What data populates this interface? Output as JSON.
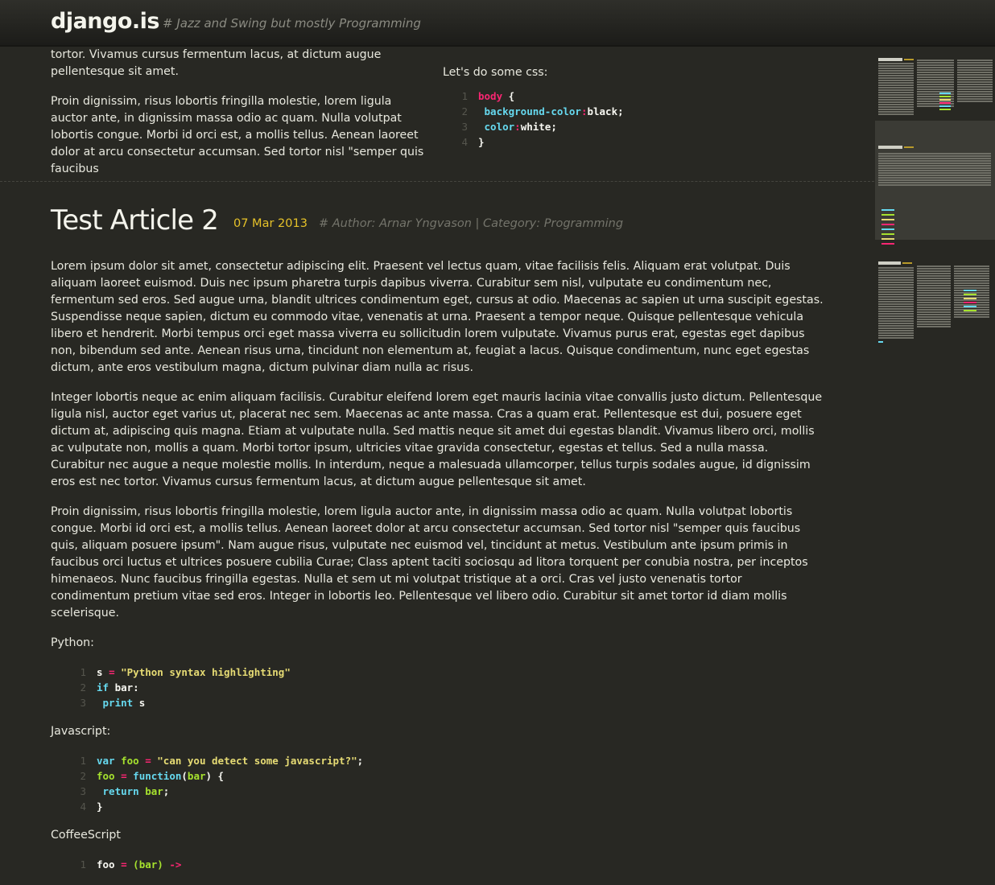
{
  "header": {
    "logo": "django.is",
    "tagline": "# Jazz and Swing but mostly Programming"
  },
  "previous_article": {
    "paragraphs": [
      "tortor. Vivamus cursus fermentum lacus, at dictum augue pellentesque sit amet.",
      "Proin dignissim, risus lobortis fringilla molestie, lorem ligula auctor ante, in dignissim massa odio ac quam. Nulla volutpat lobortis congue. Morbi id orci est, a mollis tellus. Aenean laoreet dolor at arcu consectetur accumsan. Sed tortor nisl \"semper quis faucibus"
    ],
    "css_label": "Let's do some css:",
    "css_code": [
      "body {",
      "    background-color:black;",
      "    color:white;",
      "}"
    ]
  },
  "article": {
    "title": "Test Article 2",
    "date": "07 Mar 2013",
    "meta": "# Author: Arnar Yngvason | Category: Programming",
    "paragraphs": [
      "Lorem ipsum dolor sit amet, consectetur adipiscing elit. Praesent vel lectus quam, vitae facilisis felis. Aliquam erat volutpat. Duis aliquam laoreet euismod. Duis nec ipsum pharetra turpis dapibus viverra. Curabitur sem nisl, vulputate eu condimentum nec, fermentum sed eros. Sed augue urna, blandit ultrices condimentum eget, cursus at odio. Maecenas ac sapien ut urna suscipit egestas. Suspendisse neque sapien, dictum eu commodo vitae, venenatis at urna. Praesent a tempor neque. Quisque pellentesque vehicula libero et hendrerit. Morbi tempus orci eget massa viverra eu sollicitudin lorem vulputate. Vivamus purus erat, egestas eget dapibus non, bibendum sed ante. Aenean risus urna, tincidunt non elementum at, feugiat a lacus. Quisque condimentum, nunc eget egestas dictum, ante eros vestibulum magna, dictum pulvinar diam nulla ac risus.",
      "Integer lobortis neque ac enim aliquam facilisis. Curabitur eleifend lorem eget mauris lacinia vitae convallis justo dictum. Pellentesque ligula nisl, auctor eget varius ut, placerat nec sem. Maecenas ac ante massa. Cras a quam erat. Pellentesque est dui, posuere eget dictum at, adipiscing quis magna. Etiam at vulputate nulla. Sed mattis neque sit amet dui egestas blandit. Vivamus libero orci, mollis ac vulputate non, mollis a quam. Morbi tortor ipsum, ultricies vitae gravida consectetur, egestas et tellus. Sed a nulla massa. Curabitur nec augue a neque molestie mollis. In interdum, neque a malesuada ullamcorper, tellus turpis sodales augue, id dignissim eros est nec tortor. Vivamus cursus fermentum lacus, at dictum augue pellentesque sit amet.",
      "Proin dignissim, risus lobortis fringilla molestie, lorem ligula auctor ante, in dignissim massa odio ac quam. Nulla volutpat lobortis congue. Morbi id orci est, a mollis tellus. Aenean laoreet dolor at arcu consectetur accumsan. Sed tortor nisl \"semper quis faucibus quis, aliquam posuere ipsum\". Nam augue risus, vulputate nec euismod vel, tincidunt at metus. Vestibulum ante ipsum primis in faucibus orci luctus et ultrices posuere cubilia Curae; Class aptent taciti sociosqu ad litora torquent per conubia nostra, per inceptos himenaeos. Nunc faucibus fringilla egestas. Nulla et sem ut mi volutpat tristique at a orci. Cras vel justo venenatis tortor condimentum pretium vitae sed eros. Integer in lobortis leo. Pellentesque vel libero odio. Curabitur sit amet tortor id diam mollis scelerisque."
    ],
    "python_label": "Python:",
    "javascript_label": "Javascript:",
    "coffeescript_label": "CoffeeScript",
    "line_numbers": [
      "1",
      "2",
      "3",
      "4"
    ]
  },
  "minimap": {
    "titles": [
      "Test Article 3",
      "Test Article 2",
      "Test Article"
    ],
    "logo": "django.is"
  }
}
